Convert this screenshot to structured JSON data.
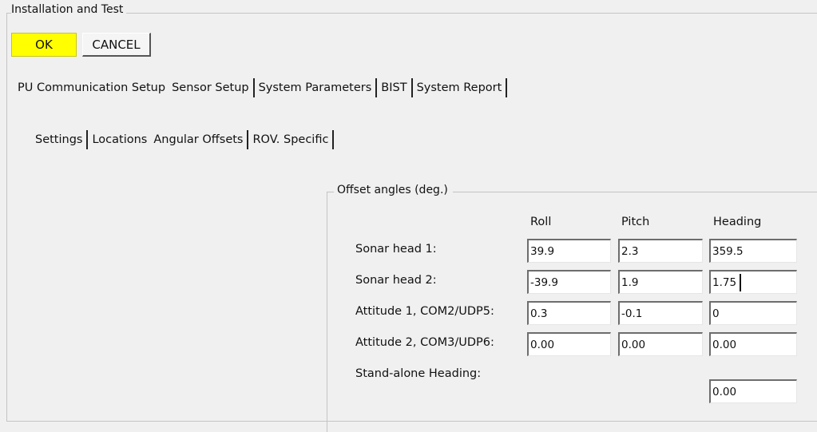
{
  "window": {
    "group_title": "Installation and Test"
  },
  "buttons": {
    "ok": "OK",
    "cancel": "CANCEL"
  },
  "main_tabs": [
    "PU Communication Setup",
    "Sensor Setup",
    "System Parameters",
    "BIST",
    "System Report"
  ],
  "sub_tabs": [
    "Settings",
    "Locations",
    "Angular Offsets",
    "ROV. Specific"
  ],
  "offsets": {
    "group_title": "Offset angles (deg.)",
    "columns": [
      "Roll",
      "Pitch",
      "Heading"
    ],
    "rows": [
      {
        "label": "Sonar head 1:",
        "roll": "39.9",
        "pitch": "2.3",
        "heading": "359.5"
      },
      {
        "label": "Sonar head 2:",
        "roll": "-39.9",
        "pitch": "1.9",
        "heading": "1.75"
      },
      {
        "label": "Attitude 1, COM2/UDP5:",
        "roll": "0.3",
        "pitch": "-0.1",
        "heading": "0"
      },
      {
        "label": "Attitude 2, COM3/UDP6:",
        "roll": "0.00",
        "pitch": "0.00",
        "heading": "0.00"
      },
      {
        "label": "Stand-alone Heading:",
        "heading": "0.00"
      }
    ]
  },
  "colors": {
    "ok_button": "#ffff00",
    "background": "#f0f0f0"
  }
}
